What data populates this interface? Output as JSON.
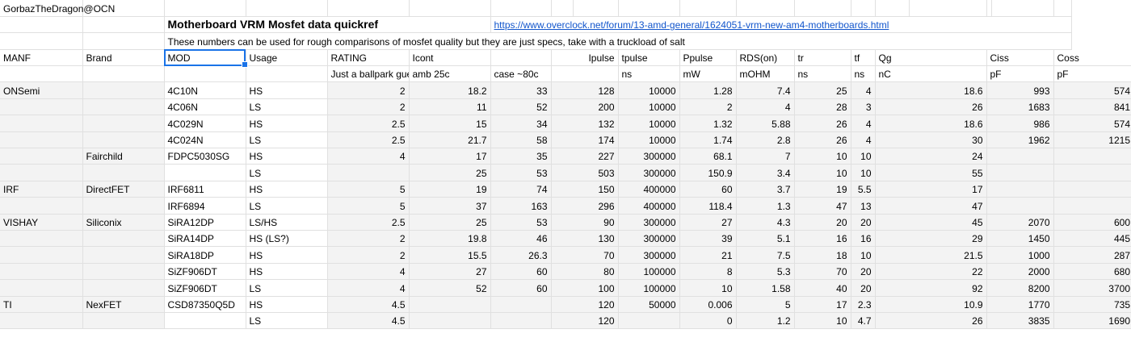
{
  "author": "GorbazTheDragon@OCN",
  "title": "Motherboard VRM Mosfet data quickref",
  "link": "https://www.overclock.net/forum/13-amd-general/1624051-vrm-new-am4-motherboards.html",
  "note": "These numbers can be used for rough comparisons of mosfet quality but they are just specs, take with a truckload of salt",
  "headers": [
    "MANF",
    "Brand",
    "MOD",
    "Usage",
    "RATING",
    "Icont",
    "",
    "Ipulse",
    "tpulse",
    "Ppulse",
    "RDS(on)",
    "tr",
    "tf",
    "Qg",
    "",
    "Ciss",
    "",
    "Coss"
  ],
  "units": [
    "",
    "",
    "",
    "",
    "Just a ballpark guess",
    "amb 25c",
    "case ~80c",
    "",
    "ns",
    "mW",
    "mOHM",
    "ns",
    "ns",
    "nC",
    "",
    "pF",
    "",
    "pF"
  ],
  "rows": [
    {
      "manf": "ONSemi",
      "brand": "",
      "mod": "4C10N",
      "usage": "HS",
      "rating": "2",
      "icont_amb": "18.2",
      "icont_case": "33",
      "ipulse": "128",
      "tpulse": "10000",
      "ppulse": "1.28",
      "rds": "7.4",
      "tr": "25",
      "tf": "4",
      "qg": "18.6",
      "ciss": "993",
      "coss": "574"
    },
    {
      "manf": "",
      "brand": "",
      "mod": "4C06N",
      "usage": "LS",
      "rating": "2",
      "icont_amb": "11",
      "icont_case": "52",
      "ipulse": "200",
      "tpulse": "10000",
      "ppulse": "2",
      "rds": "4",
      "tr": "28",
      "tf": "3",
      "qg": "26",
      "ciss": "1683",
      "coss": "841"
    },
    {
      "manf": "",
      "brand": "",
      "mod": "4C029N",
      "usage": "HS",
      "rating": "2.5",
      "icont_amb": "15",
      "icont_case": "34",
      "ipulse": "132",
      "tpulse": "10000",
      "ppulse": "1.32",
      "rds": "5.88",
      "tr": "26",
      "tf": "4",
      "qg": "18.6",
      "ciss": "986",
      "coss": "574"
    },
    {
      "manf": "",
      "brand": "",
      "mod": "4C024N",
      "usage": "LS",
      "rating": "2.5",
      "icont_amb": "21.7",
      "icont_case": "58",
      "ipulse": "174",
      "tpulse": "10000",
      "ppulse": "1.74",
      "rds": "2.8",
      "tr": "26",
      "tf": "4",
      "qg": "30",
      "ciss": "1962",
      "coss": "1215"
    },
    {
      "manf": "",
      "brand": "Fairchild",
      "mod": "FDPC5030SG",
      "usage": "HS",
      "rating": "4",
      "icont_amb": "17",
      "icont_case": "35",
      "ipulse": "227",
      "tpulse": "300000",
      "ppulse": "68.1",
      "rds": "7",
      "tr": "10",
      "tf": "10",
      "qg": "24",
      "ciss": "",
      "coss": ""
    },
    {
      "manf": "",
      "brand": "",
      "mod": "",
      "usage": "LS",
      "rating": "",
      "icont_amb": "25",
      "icont_case": "53",
      "ipulse": "503",
      "tpulse": "300000",
      "ppulse": "150.9",
      "rds": "3.4",
      "tr": "10",
      "tf": "10",
      "qg": "55",
      "ciss": "",
      "coss": ""
    },
    {
      "manf": "IRF",
      "brand": "DirectFET",
      "mod": "IRF6811",
      "usage": "HS",
      "rating": "5",
      "icont_amb": "19",
      "icont_case": "74",
      "ipulse": "150",
      "tpulse": "400000",
      "ppulse": "60",
      "rds": "3.7",
      "tr": "19",
      "tf": "5.5",
      "qg": "17",
      "ciss": "",
      "coss": ""
    },
    {
      "manf": "",
      "brand": "",
      "mod": "IRF6894",
      "usage": "LS",
      "rating": "5",
      "icont_amb": "37",
      "icont_case": "163",
      "ipulse": "296",
      "tpulse": "400000",
      "ppulse": "118.4",
      "rds": "1.3",
      "tr": "47",
      "tf": "13",
      "qg": "47",
      "ciss": "",
      "coss": ""
    },
    {
      "manf": "VISHAY",
      "brand": "Siliconix",
      "mod": "SiRA12DP",
      "usage": "LS/HS",
      "rating": "2.5",
      "icont_amb": "25",
      "icont_case": "53",
      "ipulse": "90",
      "tpulse": "300000",
      "ppulse": "27",
      "rds": "4.3",
      "tr": "20",
      "tf": "20",
      "qg": "45",
      "ciss": "2070",
      "coss": "600"
    },
    {
      "manf": "",
      "brand": "",
      "mod": "SiRA14DP",
      "usage": "HS (LS?)",
      "rating": "2",
      "icont_amb": "19.8",
      "icont_case": "46",
      "ipulse": "130",
      "tpulse": "300000",
      "ppulse": "39",
      "rds": "5.1",
      "tr": "16",
      "tf": "16",
      "qg": "29",
      "ciss": "1450",
      "coss": "445"
    },
    {
      "manf": "",
      "brand": "",
      "mod": "SiRA18DP",
      "usage": "HS",
      "rating": "2",
      "icont_amb": "15.5",
      "icont_case": "26.3",
      "ipulse": "70",
      "tpulse": "300000",
      "ppulse": "21",
      "rds": "7.5",
      "tr": "18",
      "tf": "10",
      "qg": "21.5",
      "ciss": "1000",
      "coss": "287"
    },
    {
      "manf": "",
      "brand": "",
      "mod": "SiZF906DT",
      "usage": "HS",
      "rating": "4",
      "icont_amb": "27",
      "icont_case": "60",
      "ipulse": "80",
      "tpulse": "100000",
      "ppulse": "8",
      "rds": "5.3",
      "tr": "70",
      "tf": "20",
      "qg": "22",
      "ciss": "2000",
      "coss": "680"
    },
    {
      "manf": "",
      "brand": "",
      "mod": "SiZF906DT",
      "usage": "LS",
      "rating": "4",
      "icont_amb": "52",
      "icont_case": "60",
      "ipulse": "100",
      "tpulse": "100000",
      "ppulse": "10",
      "rds": "1.58",
      "tr": "40",
      "tf": "20",
      "qg": "92",
      "ciss": "8200",
      "coss": "3700"
    },
    {
      "manf": "TI",
      "brand": "NexFET",
      "mod": "CSD87350Q5D",
      "usage": "HS",
      "rating": "4.5",
      "icont_amb": "",
      "icont_case": "",
      "ipulse": "120",
      "tpulse": "50000",
      "ppulse": "0.006",
      "rds": "5",
      "tr": "17",
      "tf": "2.3",
      "qg": "10.9",
      "ciss": "1770",
      "coss": "735"
    },
    {
      "manf": "",
      "brand": "",
      "mod": "",
      "usage": "LS",
      "rating": "4.5",
      "icont_amb": "",
      "icont_case": "",
      "ipulse": "120",
      "tpulse": "",
      "ppulse": "0",
      "rds": "1.2",
      "tr": "10",
      "tf": "4.7",
      "qg": "26",
      "ciss": "3835",
      "coss": "1690"
    }
  ],
  "colors": {
    "link": "#1155cc",
    "selection": "#1a73e8",
    "shade": "#f3f3f3",
    "grid": "#e0e0e0"
  }
}
